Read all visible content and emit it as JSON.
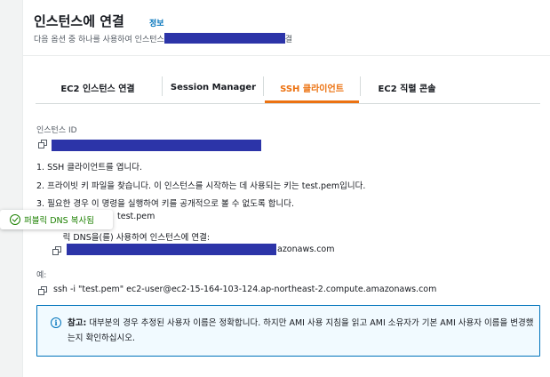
{
  "header": {
    "title": "인스턴스에 연결",
    "info_link": "정보",
    "subtitle_prefix": "다음 옵션 중 하나를 사용하여 인스턴스",
    "subtitle_suffix": "결"
  },
  "tabs": [
    {
      "label": "EC2 인스턴스 연결",
      "active": false
    },
    {
      "label": "Session Manager",
      "active": false
    },
    {
      "label": "SSH 클라이언트",
      "active": true
    },
    {
      "label": "EC2 직렬 콘솔",
      "active": false
    }
  ],
  "instance_id_label": "인스턴스 ID",
  "steps": {
    "step1": "1. SSH 클라이언트를 엽니다.",
    "step2": "2. 프라이빗 키 파일을 찾습니다. 이 인스턴스를 시작하는 데 사용되는 키는 test.pem입니다.",
    "step3": "3. 필요한 경우 이 명령을 실행하여 키를 공개적으로 볼 수 없도록 합니다.",
    "step3_cmd": "test.pem",
    "step4_visible": "4. 퍼블릭 DNS을(를) 사용하여 인스턴스에 연결:",
    "step4_dns_suffix": "azonaws.com"
  },
  "toast": {
    "message": "퍼블릭 DNS 복사됨"
  },
  "example": {
    "label": "예:",
    "command": "ssh -i \"test.pem\" ec2-user@ec2-15-164-103-124.ap-northeast-2.compute.amazonaws.com"
  },
  "note": {
    "title": "참고:",
    "body": "대부분의 경우 추정된 사용자 이름은 정확합니다. 하지만 AMI 사용 지침을 읽고 AMI 소유자가 기본 AMI 사용자 이름을 변경했는지 확인하십시오."
  },
  "colors": {
    "accent_orange": "#ec7211",
    "link_blue": "#0073bb",
    "success_green": "#1d8102",
    "redaction": "#2c34a8"
  }
}
